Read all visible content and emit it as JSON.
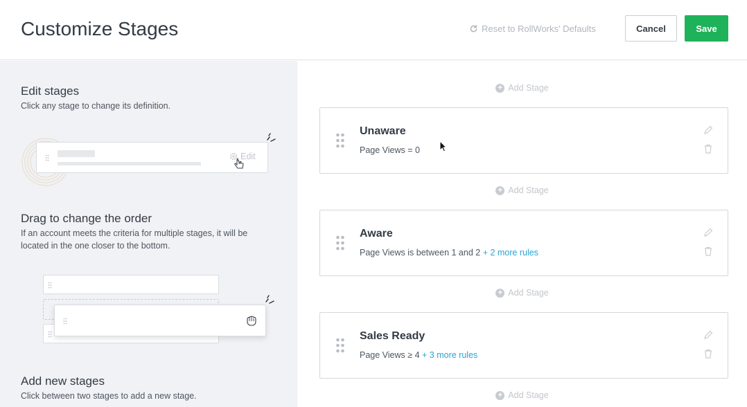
{
  "header": {
    "title": "Customize Stages",
    "reset_label": "Reset to RollWorks' Defaults",
    "cancel_label": "Cancel",
    "save_label": "Save"
  },
  "sidebar": {
    "edit": {
      "title": "Edit stages",
      "text": "Click any stage to change its definition.",
      "illustration_edit_label": "Edit"
    },
    "drag": {
      "title": "Drag to change the order",
      "text": "If an account meets the criteria for multiple stages, it will be located in the one closer to the bottom."
    },
    "add": {
      "title": "Add new stages",
      "text": "Click between two stages to add a new stage."
    }
  },
  "main": {
    "add_stage_label": "Add Stage",
    "stages": [
      {
        "name": "Unaware",
        "rule": "Page Views = 0",
        "more_rules": ""
      },
      {
        "name": "Aware",
        "rule": "Page Views is between 1 and 2",
        "more_rules": "+ 2 more rules"
      },
      {
        "name": "Sales Ready",
        "rule": "Page Views ≥ 4",
        "more_rules": "+ 3 more rules"
      }
    ]
  },
  "colors": {
    "accent_green": "#1eb25a",
    "link_blue": "#2aa3d4",
    "sidebar_bg": "#f1f2f5",
    "muted_gray": "#c2c6cb"
  },
  "icons": [
    "refresh-icon",
    "plus-circle-icon",
    "drag-handle-icon",
    "pencil-icon",
    "trash-icon",
    "gear-icon",
    "hand-pointer-icon",
    "grab-hand-icon",
    "mouse-cursor-icon"
  ]
}
